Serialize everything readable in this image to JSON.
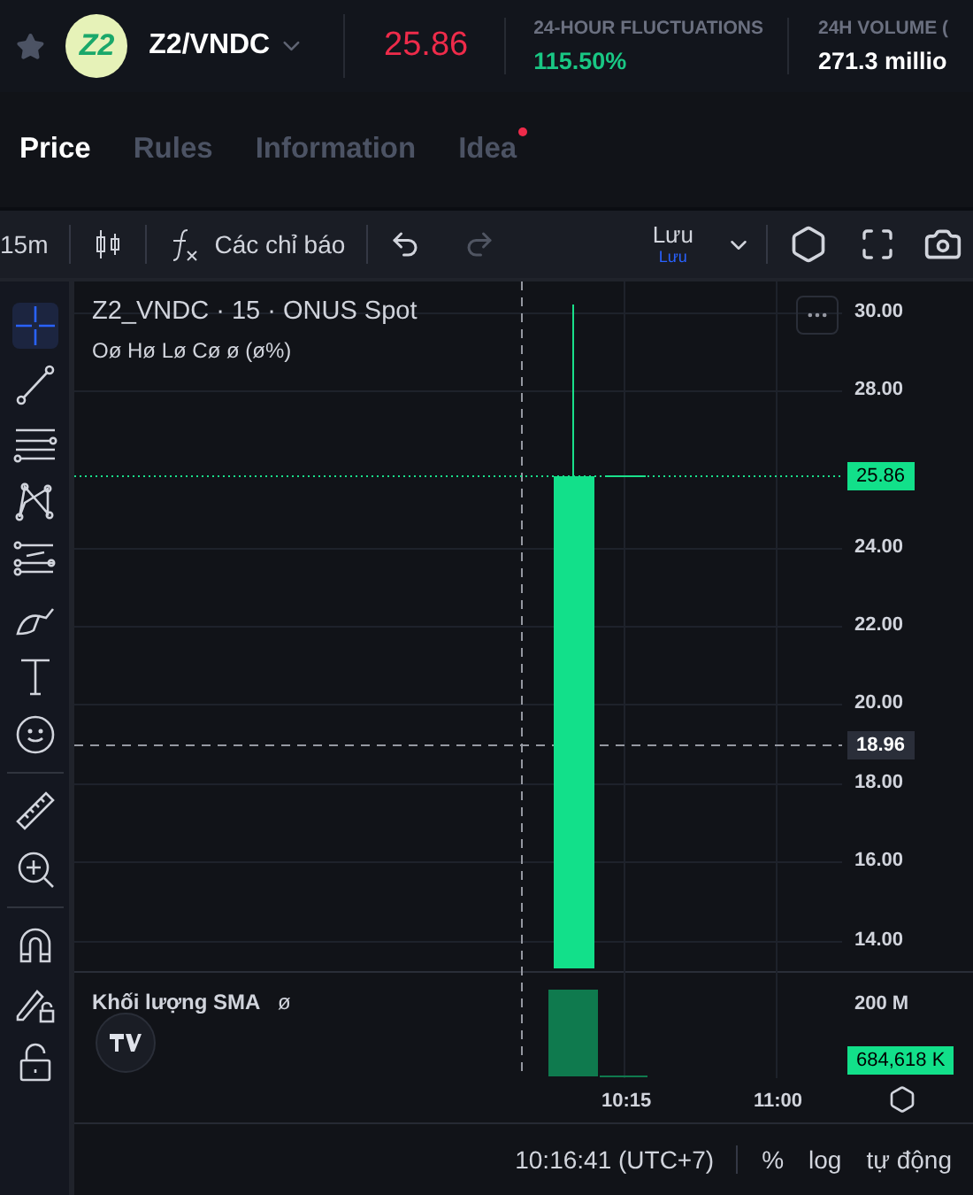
{
  "header": {
    "pair": "Z2/VNDC",
    "logo_text": "Z2",
    "price": "25.86",
    "stats": [
      {
        "label": "24-HOUR FLUCTUATIONS",
        "value": "115.50%",
        "kind": "up"
      },
      {
        "label": "24H VOLUME (",
        "value": "271.3 millio",
        "kind": "plain"
      }
    ]
  },
  "tabs": [
    {
      "label": "Price",
      "selected": true,
      "notification": false
    },
    {
      "label": "Rules",
      "selected": false,
      "notification": false
    },
    {
      "label": "Information",
      "selected": false,
      "notification": false
    },
    {
      "label": "Idea",
      "selected": false,
      "notification": true
    }
  ],
  "toolbar": {
    "interval": "15m",
    "indicators": "Các chỉ báo",
    "save": "Lưu",
    "save_sub": "Lưu"
  },
  "tools": [
    {
      "kind": "crosshair",
      "selected": true
    },
    {
      "kind": "trendline",
      "selected": false
    },
    {
      "kind": "lines",
      "selected": false
    },
    {
      "kind": "pattern",
      "selected": false
    },
    {
      "kind": "fib",
      "selected": false
    },
    {
      "kind": "brush",
      "selected": false
    },
    {
      "kind": "text",
      "selected": false
    },
    {
      "kind": "emoji",
      "selected": false
    },
    {
      "kind": "divider"
    },
    {
      "kind": "ruler",
      "selected": false
    },
    {
      "kind": "zoom",
      "selected": false
    },
    {
      "kind": "divider"
    },
    {
      "kind": "magnet",
      "selected": false
    },
    {
      "kind": "pencil-lock",
      "selected": false
    },
    {
      "kind": "lock",
      "selected": false
    }
  ],
  "chart": {
    "title": "Z2_VNDC · 15 · ONUS Spot",
    "ohlc": "Oø Hø Lø Cø ø (ø%)",
    "price_ticks": [
      "30.00",
      "28.00",
      "24.00",
      "22.00",
      "20.00",
      "18.00",
      "16.00",
      "14.00"
    ],
    "last_price": "25.86",
    "crosshair_price": "18.96",
    "volume_label": "Khối lượng SMA",
    "volume_value": "ø",
    "volume_tick": "200 M",
    "volume_last": "684,618 K",
    "time_ticks": [
      "10:15",
      "11:00"
    ]
  },
  "status": {
    "time": "10:16:41 (UTC+7)",
    "buttons": [
      "%",
      "log",
      "tự động"
    ]
  }
}
